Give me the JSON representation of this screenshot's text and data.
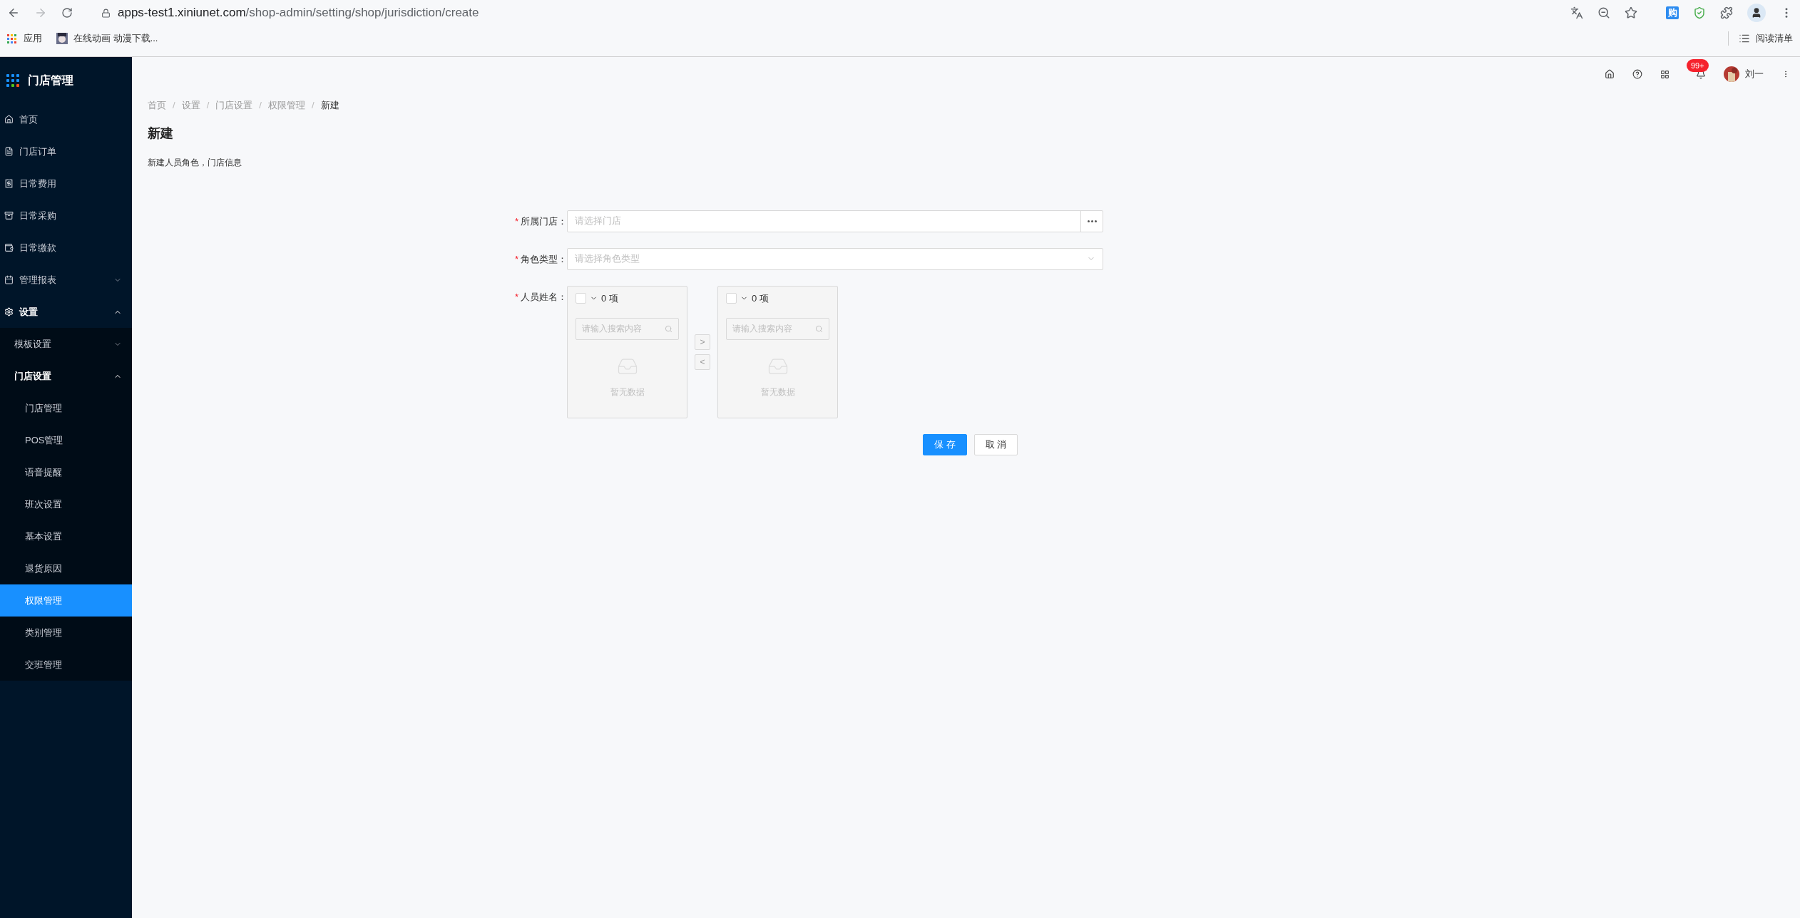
{
  "browser": {
    "url_host": "apps-test1.xiniunet.com",
    "url_path": "/shop-admin/setting/shop/jurisdiction/create",
    "extension_label": "购",
    "bookmarks": [
      "应用",
      "在线动画 动漫下载..."
    ],
    "reading_list": "阅读清单"
  },
  "sidebar": {
    "app_title": "门店管理",
    "items": [
      {
        "label": "首页",
        "selected": false
      },
      {
        "label": "门店订单",
        "selected": false
      },
      {
        "label": "日常费用",
        "selected": false
      },
      {
        "label": "日常采购",
        "selected": false
      },
      {
        "label": "日常缴款",
        "selected": false
      },
      {
        "label": "管理报表",
        "selected": false,
        "expanded": false
      },
      {
        "label": "设置",
        "selected": false,
        "expanded": true,
        "children": [
          {
            "label": "模板设置",
            "selected": false,
            "expanded": false
          },
          {
            "label": "门店设置",
            "selected": false,
            "expanded": true,
            "children": [
              {
                "label": "门店管理",
                "selected": false
              },
              {
                "label": "POS管理",
                "selected": false
              },
              {
                "label": "语音提醒",
                "selected": false
              },
              {
                "label": "班次设置",
                "selected": false
              },
              {
                "label": "基本设置",
                "selected": false
              },
              {
                "label": "退货原因",
                "selected": false
              },
              {
                "label": "权限管理",
                "selected": true
              },
              {
                "label": "类别管理",
                "selected": false
              },
              {
                "label": "交班管理",
                "selected": false
              }
            ]
          }
        ]
      }
    ]
  },
  "header": {
    "notification_badge": "99+",
    "user_name": "刘一"
  },
  "breadcrumb": [
    "首页",
    "设置",
    "门店设置",
    "权限管理",
    "新建"
  ],
  "breadcrumb_separator": "/",
  "page_title": "新建",
  "page_description": "新建人员角色，门店信息",
  "form": {
    "fields": [
      {
        "kind": "picker",
        "required_mark": "*",
        "label": "所属门店：",
        "placeholder": "请选择门店"
      },
      {
        "kind": "select",
        "required_mark": "*",
        "label": "角色类型：",
        "placeholder": "请选择角色类型"
      },
      {
        "kind": "transfer",
        "required_mark": "*",
        "label": "人员姓名：",
        "panels": [
          {
            "checked": false,
            "count": "0 项",
            "search_placeholder": "请输入搜索内容",
            "empty_text": "暂无数据"
          },
          {
            "checked": false,
            "count": "0 项",
            "search_placeholder": "请输入搜索内容",
            "empty_text": "暂无数据"
          }
        ],
        "move_buttons": [
          ">",
          "<"
        ]
      }
    ],
    "buttons": [
      {
        "kind": "primary",
        "label": "保 存"
      },
      {
        "kind": "default",
        "label": "取 消"
      }
    ]
  }
}
